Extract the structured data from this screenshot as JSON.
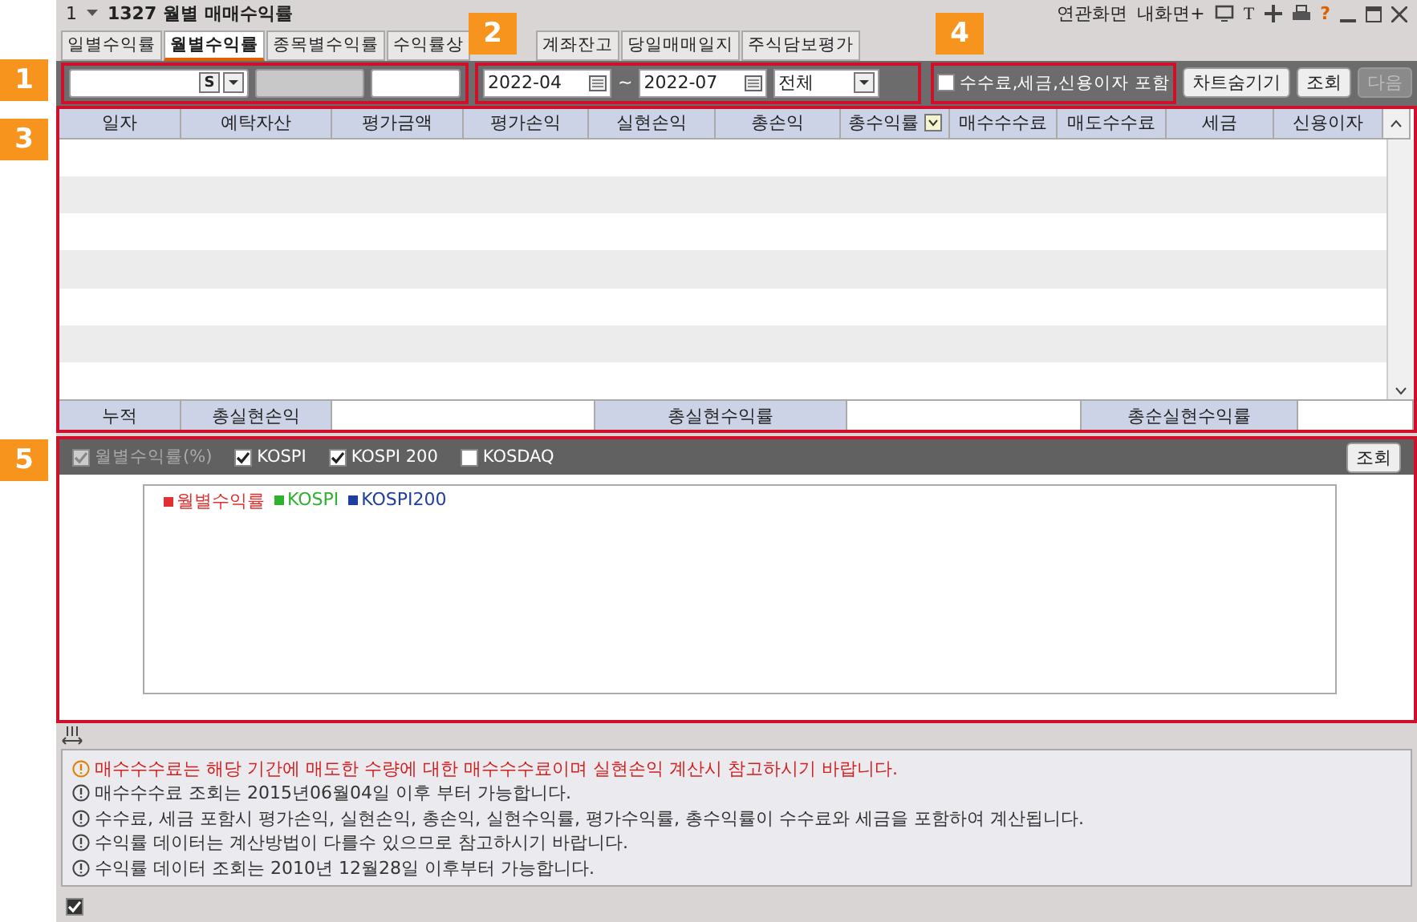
{
  "title_bar": {
    "menu": "1",
    "screen_title": "1327 월별 매매수익률",
    "related": "연관화면",
    "my_screen": "내화면+",
    "font_button": "T",
    "help": "?"
  },
  "tabs": [
    {
      "label": "일별수익률",
      "selected": false
    },
    {
      "label": "월별수익률",
      "selected": true
    },
    {
      "label": "종목별수익률",
      "selected": false
    },
    {
      "label": "수익률상",
      "selected": false
    },
    {
      "label": "계좌잔고",
      "selected": false
    },
    {
      "label": "당일매매일지",
      "selected": false
    },
    {
      "label": "주식담보평가",
      "selected": false
    }
  ],
  "callouts": [
    "1",
    "2",
    "3",
    "4",
    "5"
  ],
  "toolbar": {
    "account_badge": "S",
    "from": "2022-04",
    "tilde": "~",
    "to": "2022-07",
    "filter": "전체",
    "include_fees": {
      "label": "수수료,세금,신용이자 포함",
      "checked": false
    },
    "buttons": [
      {
        "label": "차트숨기기",
        "disabled": false
      },
      {
        "label": "조회",
        "disabled": false
      },
      {
        "label": "다음",
        "disabled": true
      }
    ]
  },
  "table": {
    "columns": [
      "일자",
      "예탁자산",
      "평가금액",
      "평가손익",
      "실현손익",
      "총손익",
      "총수익률",
      "매수수수료",
      "매도수수료",
      "세금",
      "신용이자"
    ],
    "summary": [
      "누적",
      "총실현손익",
      "총실현수익률",
      "총순실현수익률"
    ]
  },
  "chart": {
    "series": [
      {
        "label": "월별수익률(%)",
        "checked": true,
        "disabled": true
      },
      {
        "label": "KOSPI",
        "checked": true,
        "disabled": false
      },
      {
        "label": "KOSPI 200",
        "checked": true,
        "disabled": false
      },
      {
        "label": "KOSDAQ",
        "checked": false,
        "disabled": false
      }
    ],
    "query_button": "조회",
    "legend": [
      {
        "label": "월별수익률",
        "color": "#e03030"
      },
      {
        "label": "KOSPI",
        "color": "#30b030"
      },
      {
        "label": "KOSPI200",
        "color": "#2040a0"
      }
    ]
  },
  "notes": [
    {
      "kind": "warning",
      "text": "매수수수료는 해당 기간에 매도한 수량에 대한 매수수수료이며 실현손익 계산시 참고하시기 바랍니다."
    },
    {
      "kind": "info",
      "text": "매수수수료 조회는 2015년06월04일 이후 부터 가능합니다."
    },
    {
      "kind": "info",
      "text": "수수료, 세금 포함시 평가손익, 실현손익, 총손익, 실현수익률, 평가수익률, 총수익률이 수수료와 세금을 포함하여 계산됩니다."
    },
    {
      "kind": "info",
      "text": "수익률 데이터는 계산방법이 다를수 있으므로 참고하시기 바랍니다."
    },
    {
      "kind": "info",
      "text": "수익률 데이터 조회는 2010년 12월28일 이후부터 가능합니다."
    }
  ],
  "footer": {
    "checked": true
  }
}
